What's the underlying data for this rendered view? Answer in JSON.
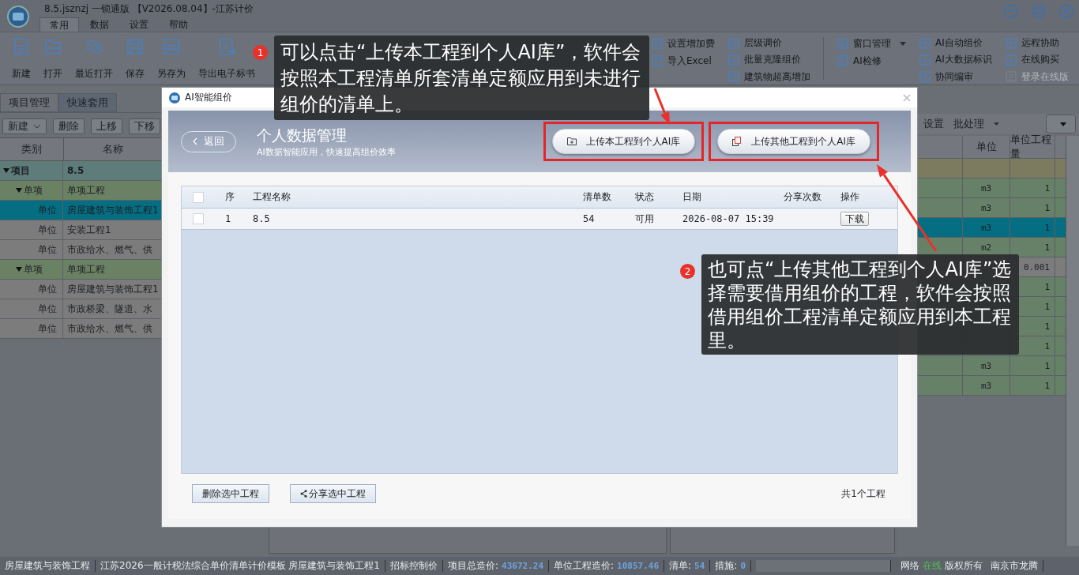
{
  "window": {
    "title": "8.5.jsznzj 一锁通版 【V2026.08.04】-江苏计价"
  },
  "ribbon_tabs": [
    {
      "label": "常用",
      "selected": true
    },
    {
      "label": "数据",
      "selected": false
    },
    {
      "label": "设置",
      "selected": false
    },
    {
      "label": "帮助",
      "selected": false
    }
  ],
  "ribbon_large": [
    {
      "label": "新建",
      "kind": "new"
    },
    {
      "label": "打开",
      "kind": "open"
    },
    {
      "label": "最近打开",
      "kind": "recent"
    },
    {
      "label": "保存",
      "kind": "save"
    },
    {
      "label": "另存为",
      "kind": "saveas"
    },
    {
      "label": "导出电子标书",
      "kind": "export"
    }
  ],
  "ribbon_small": [
    {
      "items": [
        {
          "label": "设置增加费",
          "dropdown": false,
          "disabled": false
        },
        {
          "label": "导入Excel",
          "dropdown": false,
          "disabled": false
        }
      ]
    },
    {
      "items": [
        {
          "label": "层级调价",
          "dropdown": false,
          "disabled": false
        },
        {
          "label": "批量克隆组价",
          "dropdown": false,
          "disabled": false
        },
        {
          "label": "建筑物超高增加",
          "dropdown": false,
          "disabled": false
        }
      ]
    },
    {
      "items": [
        {
          "label": "窗口管理",
          "dropdown": true,
          "disabled": false
        },
        {
          "label": "AI检修",
          "dropdown": false,
          "disabled": false
        }
      ]
    },
    {
      "items": [
        {
          "label": "AI自动组价",
          "dropdown": false,
          "disabled": false
        },
        {
          "label": "AI大数据标识",
          "dropdown": false,
          "disabled": false
        },
        {
          "label": "协同编审",
          "dropdown": false,
          "disabled": false
        }
      ]
    },
    {
      "items": [
        {
          "label": "远程协助",
          "dropdown": false,
          "disabled": false
        },
        {
          "label": "在线购买",
          "dropdown": false,
          "disabled": false
        },
        {
          "label": "登录在线版",
          "dropdown": false,
          "disabled": true
        }
      ]
    }
  ],
  "left_panel": {
    "tabs": [
      {
        "label": "项目管理",
        "selected": true
      },
      {
        "label": "快速套用",
        "selected": false
      }
    ],
    "toolbar": [
      {
        "label": "新建",
        "dropdown": true
      },
      {
        "label": "删除",
        "dropdown": false
      },
      {
        "label": "上移",
        "dropdown": false
      },
      {
        "label": "下移",
        "dropdown": false
      }
    ],
    "tree": {
      "columns": [
        "类别",
        "名称"
      ],
      "rows": [
        {
          "type": "项目",
          "name": "8.5",
          "selected": false,
          "expanded": true,
          "children": [
            {
              "type": "单项",
              "name": "单项工程",
              "selected": false,
              "expanded": true,
              "children": [
                {
                  "type": "单位",
                  "name": "房屋建筑与装饰工程1",
                  "selected": true
                },
                {
                  "type": "单位",
                  "name": "安装工程1",
                  "selected": false
                },
                {
                  "type": "单位",
                  "name": "市政给水、燃气、供",
                  "selected": false
                }
              ]
            },
            {
              "type": "单项",
              "name": "单项工程",
              "selected": false,
              "expanded": true,
              "children": [
                {
                  "type": "单位",
                  "name": "房屋建筑与装饰工程1",
                  "selected": false
                },
                {
                  "type": "单位",
                  "name": "市政桥梁、隧道、水",
                  "selected": false
                },
                {
                  "type": "单位",
                  "name": "市政给水、燃气、供",
                  "selected": false
                }
              ]
            }
          ]
        }
      ]
    }
  },
  "right_panel": {
    "toolbar": [
      {
        "label": "设置",
        "dropdown": false
      },
      {
        "label": "批处理",
        "dropdown": true
      }
    ],
    "columns": [
      "单位",
      "单位工程量"
    ],
    "rows": [
      {
        "kind": "total",
        "selected": false
      },
      {
        "kind": "item",
        "unit": "m3",
        "quantity": "1",
        "selected": false
      },
      {
        "kind": "item",
        "unit": "m3",
        "quantity": "1",
        "selected": false
      },
      {
        "kind": "item",
        "unit": "m3",
        "quantity": "1",
        "selected": true
      },
      {
        "kind": "item",
        "unit": "m2",
        "quantity": "1",
        "selected": false
      },
      {
        "kind": "measure",
        "quantity": "0.001",
        "selected": false
      },
      {
        "kind": "item",
        "quantity": "1",
        "selected": false
      },
      {
        "kind": "item",
        "quantity": "1",
        "selected": false
      },
      {
        "kind": "item",
        "quantity": "1",
        "selected": false
      },
      {
        "kind": "item",
        "quantity": "1",
        "selected": false
      },
      {
        "kind": "item",
        "unit": "m3",
        "quantity": "1",
        "selected": false
      },
      {
        "kind": "item",
        "unit": "m3",
        "quantity": "1",
        "selected": false
      }
    ]
  },
  "status_bar": {
    "items": [
      {
        "label": "房屋建筑与装饰工程"
      },
      {
        "label": "江苏2026一般计税法综合单价清单计价模板 房屋建筑与装饰工程1"
      },
      {
        "label": "招标控制价"
      },
      {
        "label": "项目总造价:",
        "value": "43672.24"
      },
      {
        "label": "单位工程造价:",
        "value": "10857.46"
      },
      {
        "label": "清单:",
        "value": "54"
      },
      {
        "label": "措施:",
        "value": "0"
      }
    ],
    "network": {
      "prefix": "网络",
      "state": "在线",
      "online": true,
      "suffix": "版权所有"
    },
    "company": "南京市龙腾"
  },
  "dialog": {
    "title": "AI智能组价",
    "back": "返回",
    "heading": "个人数据管理",
    "subheading": "AI数据智能应用，快速提高组价效率",
    "actions": [
      {
        "label": "上传本工程到个人AI库",
        "kind": "upload",
        "highlighted": true
      },
      {
        "label": "上传其他工程到个人AI库",
        "kind": "copy",
        "highlighted": true
      }
    ],
    "table": {
      "header_checked": false,
      "columns": [
        "序",
        "工程名称",
        "清单数",
        "状态",
        "日期",
        "分享次数",
        "操作"
      ],
      "rows": [
        {
          "checked": false,
          "index": "1",
          "name": "8.5",
          "count": "54",
          "status": "可用",
          "date": "2026-08-07 15:39",
          "action": "下载"
        }
      ]
    },
    "footer_buttons": [
      {
        "label": "删除选中工程",
        "kind": "plain"
      },
      {
        "label": "分享选中工程",
        "kind": "share"
      }
    ],
    "total": "共1个工程"
  },
  "callouts": [
    {
      "badge": "1",
      "text": "可以点击“上传本工程到个人AI库”，软件会按照本工程清单所套清单定额应用到未进行组价的清单上。"
    },
    {
      "badge": "2",
      "text": "也可点“上传其他工程到个人AI库”选择需要借用组价的工程，软件会按照借用组价工程清单定额应用到本工程里。"
    }
  ]
}
